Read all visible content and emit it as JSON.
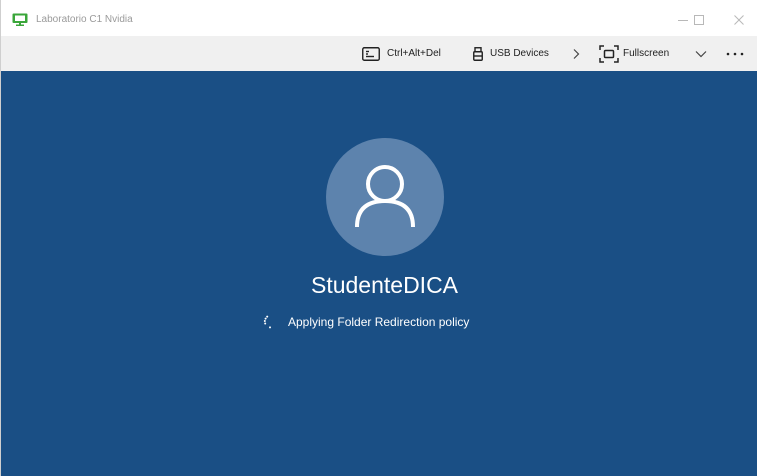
{
  "window": {
    "title": "Laboratorio C1 Nvidia",
    "app_icon": "remote-desktop-icon",
    "controls": [
      "minimize-icon",
      "maximize-icon",
      "close-icon"
    ]
  },
  "toolbar": {
    "ctrl_alt_del_label": "Ctrl+Alt+Del",
    "ctrl_alt_del_icon": "keyboard-icon",
    "usb_label": "USB Devices",
    "usb_icon": "usb-icon",
    "expand_icon": "chevron-right-icon",
    "fullscreen_label": "Fullscreen",
    "fullscreen_icon": "fullscreen-icon",
    "collapse_icon": "chevron-down-icon",
    "more_icon": "more-icon"
  },
  "session": {
    "username": "StudenteDICA",
    "status": "Applying Folder Redirection policy",
    "avatar_icon": "user-icon",
    "spinner_icon": "loading-spinner-icon"
  },
  "colors": {
    "screen_background": "#1a4f85",
    "avatar_background": "#5d83ad",
    "toolbar_background": "#f0f0f0",
    "app_icon_green": "#3aa63a"
  }
}
